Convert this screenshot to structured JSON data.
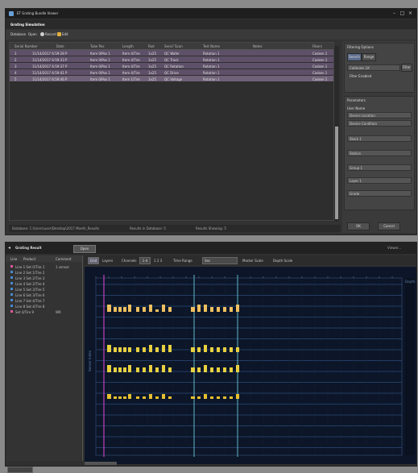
{
  "top_window": {
    "title": "ET Grating Bundle Viewer",
    "header": "Grating Simulation",
    "toolbar": {
      "database": "Database",
      "open": "Open",
      "record": "Record",
      "edit": "Edit"
    },
    "grid": {
      "columns": [
        "Serial Number",
        "Date",
        "Tube Pos",
        "Length",
        "Rod",
        "Sens? Scan",
        "Test Name",
        "Notes",
        "Fibers"
      ],
      "rows": [
        [
          "1",
          "11/14/2017 6:59:28 P",
          "Item 0/Pos 1",
          "Item 4/Tire",
          "1x25",
          "QC Wafer",
          "Rotation 1",
          "",
          "Casken 1"
        ],
        [
          "2",
          "11/14/2017 6:59:33 P",
          "Item 0/Pos 1",
          "Item 4/Tire",
          "1x25",
          "QC Track",
          "Rotation 1",
          "",
          "Casken 1"
        ],
        [
          "3",
          "11/14/2017 6:59:37 P",
          "Item 0/Pos 1",
          "Item 4/Tire",
          "1x25",
          "QC Rotation",
          "Rotation 1",
          "",
          "Casken 1"
        ],
        [
          "4",
          "11/14/2017 6:59:41 P",
          "Item 0/Pos 1",
          "Item 4/Tire",
          "1x25",
          "QC Drive",
          "Rotation 1",
          "",
          "Casken 1"
        ],
        [
          "5",
          "11/14/2017 6:59:46 P",
          "Item 0/Pos 1",
          "Item 1/Tire",
          "1x25",
          "QC Voltage",
          "Rotation 1",
          "",
          "Casken 1"
        ]
      ]
    },
    "status": {
      "database": "Database: C:\\Users\\user\\Desktop\\2017 Month_Results",
      "results": "Results in Database: 5",
      "shown": "Results Showing: 5"
    },
    "right_panel": {
      "filter_title": "Filtering Options",
      "tab_search": "Search",
      "tab_range": "Range",
      "filter_value": "Calibrate 3X",
      "filter_btn": "Filter",
      "filter_check": "Filter Enabled",
      "params_title": "Parameters",
      "user_name": "User Name",
      "fields": [
        "Device Location",
        "Device Condition",
        "Stack 1",
        "Station",
        "Group 1",
        "Layer 1",
        "Grade"
      ],
      "ok": "OK",
      "cancel": "Cancel"
    }
  },
  "bottom_window": {
    "title": "Grating Result",
    "open_btn": "Open",
    "minimize": "Viewer...",
    "left_panel": {
      "columns": [
        "Line",
        "Product",
        "Comment"
      ],
      "rows": [
        {
          "label": "Line 1 Set 0/Tire 1",
          "comment": "1 sensor",
          "color": "#e05a9a"
        },
        {
          "label": "Line 2 Set 1/Tire 2",
          "comment": "",
          "color": "#4a8ad0"
        },
        {
          "label": "Line 3 Set 2/Tire 3",
          "comment": "",
          "color": "#4a8ad0"
        },
        {
          "label": "Line 4 Set 2/Tire 4",
          "comment": "",
          "color": "#4a8ad0"
        },
        {
          "label": "Line 5 Set 3/Tire 5",
          "comment": "",
          "color": "#4a8ad0"
        },
        {
          "label": "Line 6 Set 3/Tire 6",
          "comment": "",
          "color": "#4a8ad0"
        },
        {
          "label": "Line 7 Set 4/Tire 7",
          "comment": "",
          "color": "#4a8ad0"
        },
        {
          "label": "Line 8 Set 4/Tire 8",
          "comment": "",
          "color": "#4a8ad0"
        },
        {
          "label": "Set 4/Tire 9",
          "comment": "WR",
          "color": "#e05a9a"
        }
      ]
    },
    "chart_toolbar": {
      "view": "Grid",
      "layers": "Layers",
      "channels": "Channels",
      "channel_value": "1-4",
      "zoom": "1   2   3",
      "time_range": "Time Range",
      "time_value": "Sec",
      "marker_label": "Marker Scale",
      "scale_label": "Depth Scale"
    },
    "plot": {
      "right_axis_title": "Depth Length",
      "left_axis_title": "Sensor Index"
    }
  },
  "chart_data": {
    "type": "bar",
    "title": "",
    "rows": [
      {
        "bars": [
          3,
          2,
          2,
          2,
          3,
          2,
          2,
          3,
          1,
          3,
          2,
          2,
          3,
          3,
          2,
          2,
          2,
          2,
          3
        ],
        "color": "#f0c060"
      },
      {
        "bars": [
          3,
          2,
          2,
          2,
          2,
          2,
          2,
          3,
          2,
          3,
          3,
          2,
          2,
          3,
          2,
          2,
          2,
          2,
          2
        ],
        "color": "#e8d040"
      },
      {
        "bars": [
          3,
          2,
          2,
          2,
          3,
          2,
          2,
          3,
          2,
          3,
          2,
          2,
          2,
          3,
          2,
          2,
          2,
          2,
          3
        ],
        "color": "#e8d040"
      },
      {
        "bars": [
          2,
          1,
          1,
          1,
          2,
          1,
          1,
          2,
          1,
          2,
          1,
          1,
          1,
          2,
          1,
          1,
          1,
          1,
          2
        ],
        "color": "#e8c030"
      }
    ],
    "grid": true
  }
}
